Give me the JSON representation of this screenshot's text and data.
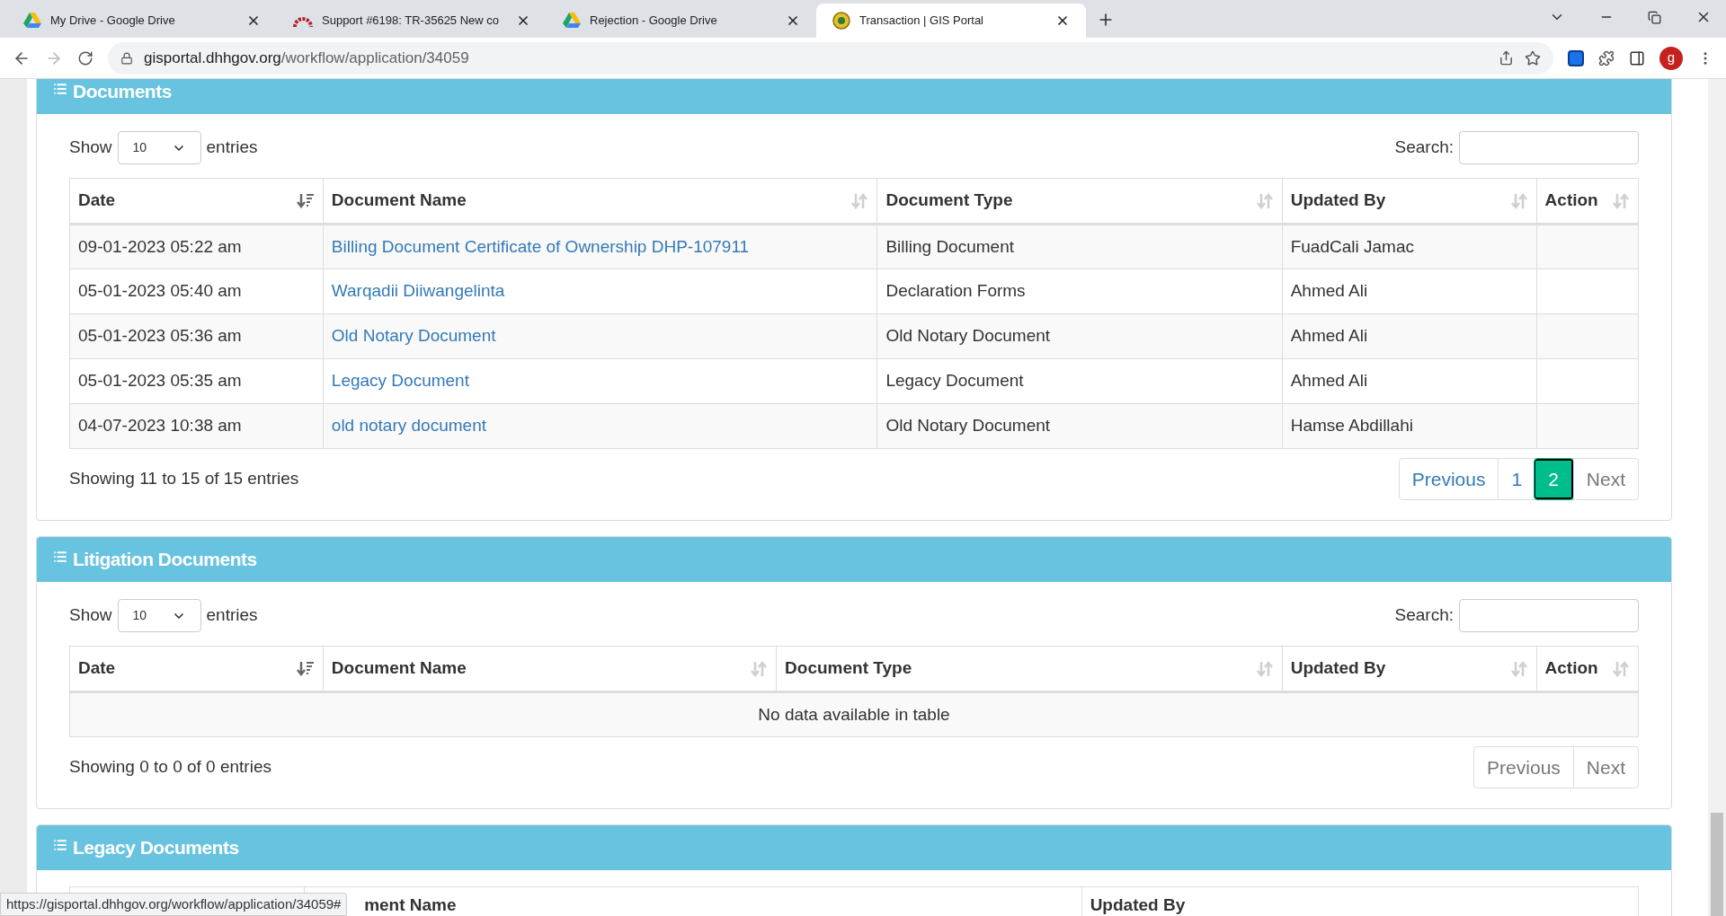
{
  "browser": {
    "tabs": [
      {
        "title": "My Drive - Google Drive",
        "kind": "drive",
        "selected": false
      },
      {
        "title": "Support #6198: TR-35625 New co",
        "kind": "arc",
        "selected": false
      },
      {
        "title": "Rejection - Google Drive",
        "kind": "drive",
        "selected": false
      },
      {
        "title": "Transaction | GIS Portal",
        "kind": "emblem",
        "selected": true
      }
    ],
    "url_host": "gisportal.dhhgov.org",
    "url_path": "/workflow/application/34059",
    "profile": "g",
    "status_url": "https://gisportal.dhhgov.org/workflow/application/34059#"
  },
  "sections": [
    {
      "title": "Documents",
      "show_label": "Show",
      "length": "10",
      "entries_label": "entries",
      "search_label": "Search:",
      "columns": [
        {
          "label": "Date",
          "sorted": true
        },
        {
          "label": "Document Name",
          "sorted": false
        },
        {
          "label": "Document Type",
          "sorted": false
        },
        {
          "label": "Updated By",
          "sorted": false
        },
        {
          "label": "Action",
          "sorted": false
        }
      ],
      "rows": [
        [
          "09-01-2023 05:22 am",
          "Billing Document Certificate of Ownership DHP-107911",
          "Billing Document",
          "FuadCali Jamac"
        ],
        [
          "05-01-2023 05:40 am",
          "Warqadii Diiwangelinta",
          "Declaration Forms",
          "Ahmed Ali"
        ],
        [
          "05-01-2023 05:36 am",
          "Old Notary Document",
          "Old Notary Document",
          "Ahmed Ali"
        ],
        [
          "05-01-2023 05:35 am",
          "Legacy Document",
          "Legacy Document",
          "Ahmed Ali"
        ],
        [
          "04-07-2023 10:38 am",
          "old notary document",
          "Old Notary Document",
          "Hamse Abdillahi"
        ]
      ],
      "info": "Showing 11 to 15 of 15 entries",
      "pagination": [
        {
          "label": "Previous",
          "selected": false,
          "disabled": false
        },
        {
          "label": "1",
          "selected": false,
          "disabled": false
        },
        {
          "label": "2",
          "selected": true,
          "disabled": false
        },
        {
          "label": "Next",
          "selected": false,
          "disabled": true
        }
      ]
    },
    {
      "title": "Litigation Documents",
      "show_label": "Show",
      "length": "10",
      "entries_label": "entries",
      "search_label": "Search:",
      "columns": [
        {
          "label": "Date",
          "sorted": true
        },
        {
          "label": "Document Name",
          "sorted": false
        },
        {
          "label": "Document Type",
          "sorted": false
        },
        {
          "label": "Updated By",
          "sorted": false
        },
        {
          "label": "Action",
          "sorted": false
        }
      ],
      "empty_message": "No data available in table",
      "info": "Showing 0 to 0 of 0 entries",
      "pagination": [
        {
          "label": "Previous",
          "selected": false,
          "disabled": true
        },
        {
          "label": "Next",
          "selected": false,
          "disabled": true
        }
      ]
    },
    {
      "title": "Legacy Documents",
      "columns": [
        {},
        {
          "label": "ment Name"
        },
        {
          "label": "Updated By"
        }
      ]
    }
  ]
}
